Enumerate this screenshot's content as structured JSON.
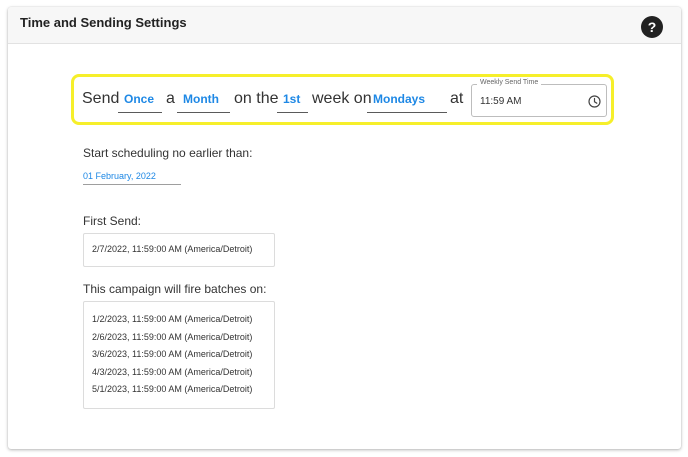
{
  "header": {
    "title": "Time and Sending Settings",
    "help_label": "?"
  },
  "schedule": {
    "send_text": "Send",
    "frequency": "Once",
    "a_text": "a",
    "period": "Month",
    "on_the_text": "on the",
    "week_ordinal": "1st",
    "week_on_text": "week on",
    "weekday": "Mondays",
    "at_text": "at",
    "time_label": "Weekly Send Time",
    "time_value": "11:59 AM"
  },
  "start": {
    "label": "Start scheduling no earlier than:",
    "date": "01 February, 2022"
  },
  "first_send": {
    "label": "First Send:",
    "value": "2/7/2022, 11:59:00 AM (America/Detroit)"
  },
  "batches": {
    "label": "This campaign will fire batches on:",
    "items": [
      "1/2/2023, 11:59:00 AM (America/Detroit)",
      "2/6/2023, 11:59:00 AM (America/Detroit)",
      "3/6/2023, 11:59:00 AM (America/Detroit)",
      "4/3/2023, 11:59:00 AM (America/Detroit)",
      "5/1/2023, 11:59:00 AM (America/Detroit)"
    ]
  },
  "icons": {
    "help": "help-icon",
    "clock": "clock-icon"
  },
  "colors": {
    "accent": "#1e88e5",
    "highlight_border": "#f6ef2a",
    "help_button": "#222222"
  }
}
